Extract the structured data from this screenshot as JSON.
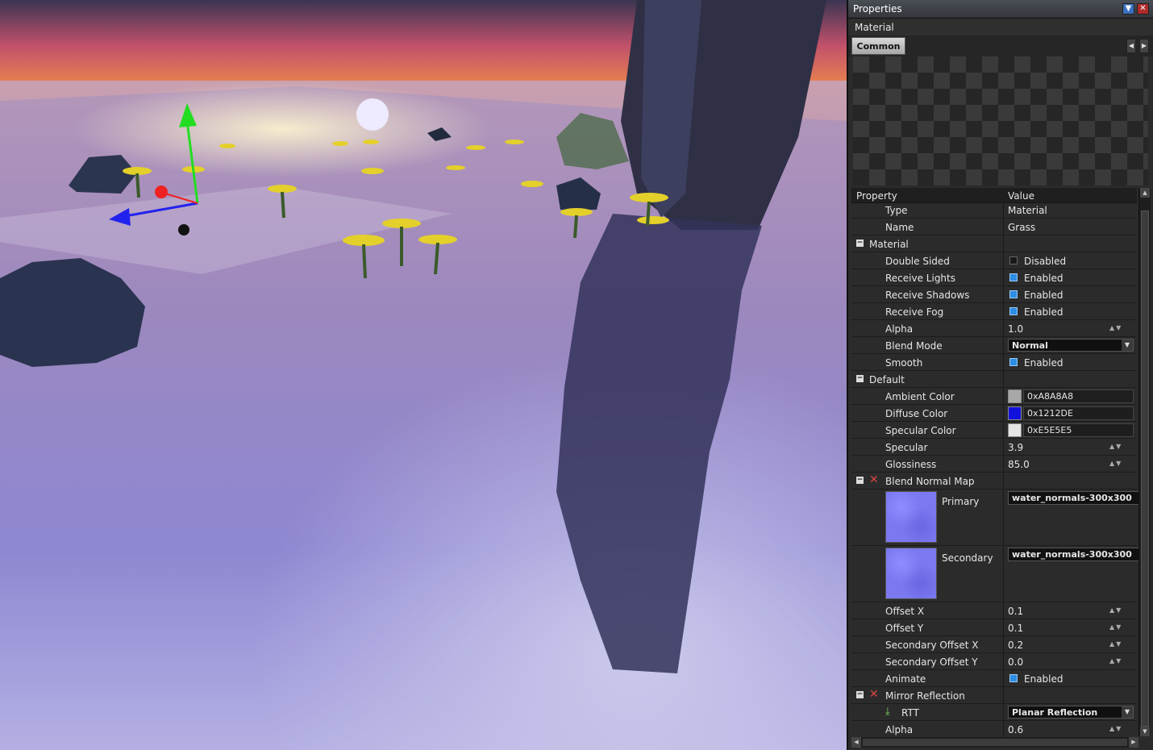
{
  "window": {
    "title": "Properties",
    "subtitle": "Material",
    "tab": "Common"
  },
  "grid": {
    "header": {
      "property": "Property",
      "value": "Value"
    },
    "type": {
      "label": "Type",
      "value": "Material"
    },
    "name": {
      "label": "Name",
      "value": "Grass"
    },
    "material_section": "Material",
    "double_sided": {
      "label": "Double Sided",
      "value": "Disabled",
      "checked": false
    },
    "receive_lights": {
      "label": "Receive Lights",
      "value": "Enabled",
      "checked": true
    },
    "receive_shadows": {
      "label": "Receive Shadows",
      "value": "Enabled",
      "checked": true
    },
    "receive_fog": {
      "label": "Receive Fog",
      "value": "Enabled",
      "checked": true
    },
    "alpha": {
      "label": "Alpha",
      "value": "1.0"
    },
    "blend_mode": {
      "label": "Blend Mode",
      "value": "Normal"
    },
    "smooth": {
      "label": "Smooth",
      "value": "Enabled",
      "checked": true
    },
    "default_section": "Default",
    "ambient_color": {
      "label": "Ambient Color",
      "value": "0xA8A8A8",
      "color": "#A8A8A8"
    },
    "diffuse_color": {
      "label": "Diffuse Color",
      "value": "0x1212DE",
      "color": "#1212DE"
    },
    "specular_color": {
      "label": "Specular Color",
      "value": "0xE5E5E5",
      "color": "#E5E5E5"
    },
    "specular": {
      "label": "Specular",
      "value": "3.9"
    },
    "glossiness": {
      "label": "Glossiness",
      "value": "85.0"
    },
    "blend_normal_map_section": "Blend Normal Map",
    "primary": {
      "label": "Primary",
      "value": "water_normals-300x300"
    },
    "secondary": {
      "label": "Secondary",
      "value": "water_normals-300x300"
    },
    "offset_x": {
      "label": "Offset X",
      "value": "0.1"
    },
    "offset_y": {
      "label": "Offset Y",
      "value": "0.1"
    },
    "secondary_offset_x": {
      "label": "Secondary Offset X",
      "value": "0.2"
    },
    "secondary_offset_y": {
      "label": "Secondary Offset Y",
      "value": "0.0"
    },
    "animate": {
      "label": "Animate",
      "value": "Enabled",
      "checked": true
    },
    "mirror_reflection_section": "Mirror Reflection",
    "rtt": {
      "label": "RTT",
      "value": "Planar Reflection"
    },
    "alpha2": {
      "label": "Alpha",
      "value": "0.6"
    }
  },
  "icons": {
    "minimize": "chevron-down-icon",
    "close": "close-icon",
    "remove": "x-icon",
    "download": "download-icon"
  }
}
